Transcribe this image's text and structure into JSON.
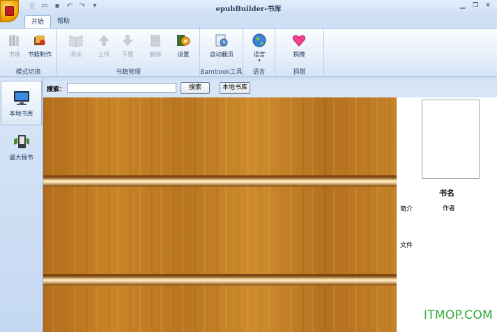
{
  "window": {
    "title": "epubBuilder-书库",
    "qat_icons": [
      "new-icon",
      "open-icon",
      "save-icon",
      "undo-icon",
      "redo-icon",
      "customize-icon"
    ],
    "controls": [
      "minimize-icon",
      "restore-icon",
      "close-icon"
    ]
  },
  "tabs": [
    {
      "label": "开始",
      "active": true
    },
    {
      "label": "帮助",
      "active": false
    }
  ],
  "ribbon": {
    "groups": [
      {
        "label": "模式切换",
        "buttons": [
          {
            "label": "书库",
            "icon": "library-icon",
            "enabled": false
          },
          {
            "label": "书籍制作",
            "icon": "book-make-icon",
            "enabled": true
          }
        ]
      },
      {
        "label": "书籍管理",
        "buttons": [
          {
            "label": "阅读",
            "icon": "read-icon",
            "enabled": false
          },
          {
            "label": "上传",
            "icon": "upload-icon",
            "enabled": false
          },
          {
            "label": "下载",
            "icon": "download-icon",
            "enabled": false
          },
          {
            "label": "删除",
            "icon": "delete-icon",
            "enabled": false
          },
          {
            "label": "设置",
            "icon": "settings-icon",
            "enabled": true
          }
        ]
      },
      {
        "label": "Bambook工具",
        "buttons": [
          {
            "label": "自动翻页",
            "icon": "auto-page-icon",
            "enabled": true
          }
        ]
      },
      {
        "label": "语言",
        "buttons": [
          {
            "label": "语言",
            "icon": "globe-icon",
            "enabled": true
          }
        ]
      },
      {
        "label": "捐赠",
        "buttons": [
          {
            "label": "捐赠",
            "icon": "heart-icon",
            "enabled": true
          }
        ]
      }
    ]
  },
  "sidebar": {
    "items": [
      {
        "label": "本地书库",
        "icon": "monitor-icon",
        "active": true
      },
      {
        "label": "盛大锦书",
        "icon": "ebook-reader-icon",
        "active": false
      }
    ]
  },
  "search": {
    "label": "搜索：",
    "value": "",
    "button": "搜索",
    "local_button": "本地书库"
  },
  "detail": {
    "book_name": "书名",
    "intro_label": "简介",
    "author_label": "作者",
    "file_label": "文件"
  },
  "watermark": "ITMOP.COM"
}
